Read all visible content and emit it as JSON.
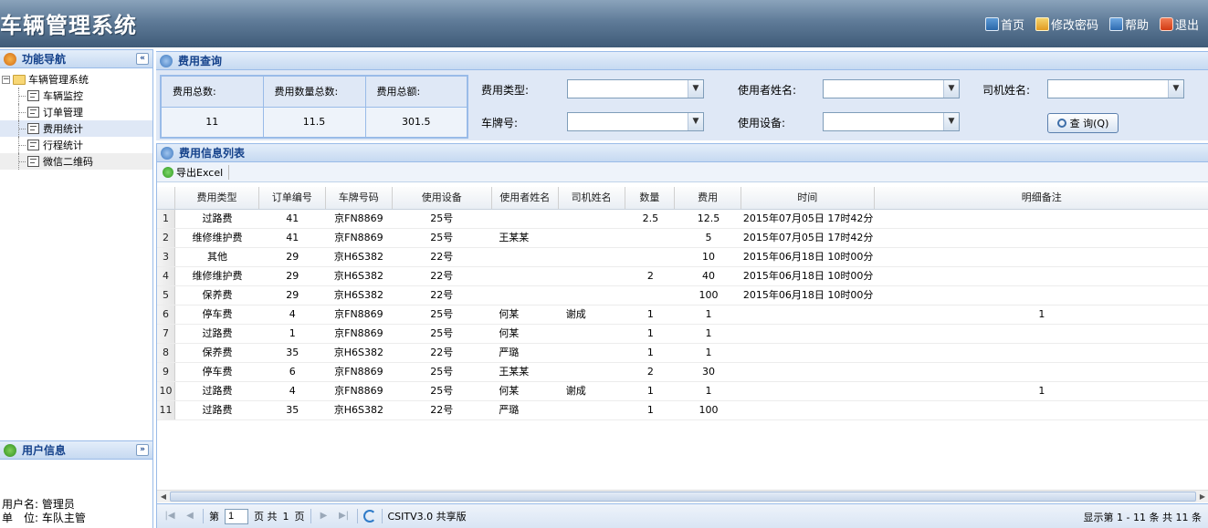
{
  "header": {
    "title": "车辆管理系统",
    "links": [
      {
        "label": "首页",
        "icon": "home-icon"
      },
      {
        "label": "修改密码",
        "icon": "key-icon"
      },
      {
        "label": "帮助",
        "icon": "help-icon"
      },
      {
        "label": "退出",
        "icon": "exit-icon"
      }
    ]
  },
  "sidebar": {
    "nav_title": "功能导航",
    "collapse_glyph": "«",
    "tree": {
      "root_label": "车辆管理系统",
      "items": [
        "车辆监控",
        "订单管理",
        "费用统计",
        "行程统计",
        "微信二维码"
      ],
      "active_item": "费用统计"
    },
    "user_panel": {
      "title": "用户信息",
      "expand_glyph": "»",
      "username_label": "用户名:",
      "username": "管理员",
      "unit_label": "单　位:",
      "unit": "车队主管"
    }
  },
  "query": {
    "title": "费用查询",
    "stats": {
      "count_label": "费用总数:",
      "quantity_label": "费用数量总数:",
      "amount_label": "费用总额:",
      "count": "11",
      "quantity": "11.5",
      "amount": "301.5"
    },
    "fields": {
      "fee_type_label": "费用类型:",
      "user_name_label": "使用者姓名:",
      "driver_name_label": "司机姓名:",
      "plate_label": "车牌号:",
      "device_label": "使用设备:"
    },
    "button_label": "查 询(Q)"
  },
  "list": {
    "title": "费用信息列表",
    "export_label": "导出Excel",
    "columns": [
      "费用类型",
      "订单编号",
      "车牌号码",
      "使用设备",
      "使用者姓名",
      "司机姓名",
      "数量",
      "费用",
      "时间",
      "明细备注"
    ],
    "rows": [
      {
        "n": "1",
        "type": "过路费",
        "order": "41",
        "plate": "京FN8869",
        "device": "25号",
        "user": "",
        "driver": "",
        "qty": "2.5",
        "cost": "12.5",
        "time": "2015年07月05日  17时42分",
        "note": ""
      },
      {
        "n": "2",
        "type": "维修维护费",
        "order": "41",
        "plate": "京FN8869",
        "device": "25号",
        "user": "王某某",
        "driver": "",
        "qty": "",
        "cost": "5",
        "time": "2015年07月05日  17时42分",
        "note": ""
      },
      {
        "n": "3",
        "type": "其他",
        "order": "29",
        "plate": "京H6S382",
        "device": "22号",
        "user": "",
        "driver": "",
        "qty": "",
        "cost": "10",
        "time": "2015年06月18日  10时00分",
        "note": ""
      },
      {
        "n": "4",
        "type": "维修维护费",
        "order": "29",
        "plate": "京H6S382",
        "device": "22号",
        "user": "",
        "driver": "",
        "qty": "2",
        "cost": "40",
        "time": "2015年06月18日  10时00分",
        "note": ""
      },
      {
        "n": "5",
        "type": "保养费",
        "order": "29",
        "plate": "京H6S382",
        "device": "22号",
        "user": "",
        "driver": "",
        "qty": "",
        "cost": "100",
        "time": "2015年06月18日  10时00分",
        "note": ""
      },
      {
        "n": "6",
        "type": "停车费",
        "order": "4",
        "plate": "京FN8869",
        "device": "25号",
        "user": "何某",
        "driver": "谢成",
        "qty": "1",
        "cost": "1",
        "time": "",
        "note": "1"
      },
      {
        "n": "7",
        "type": "过路费",
        "order": "1",
        "plate": "京FN8869",
        "device": "25号",
        "user": "何某",
        "driver": "",
        "qty": "1",
        "cost": "1",
        "time": "",
        "note": ""
      },
      {
        "n": "8",
        "type": "保养费",
        "order": "35",
        "plate": "京H6S382",
        "device": "22号",
        "user": "严璐",
        "driver": "",
        "qty": "1",
        "cost": "1",
        "time": "",
        "note": ""
      },
      {
        "n": "9",
        "type": "停车费",
        "order": "6",
        "plate": "京FN8869",
        "device": "25号",
        "user": "王某某",
        "driver": "",
        "qty": "2",
        "cost": "30",
        "time": "",
        "note": ""
      },
      {
        "n": "10",
        "type": "过路费",
        "order": "4",
        "plate": "京FN8869",
        "device": "25号",
        "user": "何某",
        "driver": "谢成",
        "qty": "1",
        "cost": "1",
        "time": "",
        "note": "1"
      },
      {
        "n": "11",
        "type": "过路费",
        "order": "35",
        "plate": "京H6S382",
        "device": "22号",
        "user": "严璐",
        "driver": "",
        "qty": "1",
        "cost": "100",
        "time": "",
        "note": ""
      }
    ]
  },
  "pager": {
    "page_prefix": "第",
    "page_value": "1",
    "page_mid": "页 共",
    "total_pages": "1",
    "page_suffix": "页",
    "version": "CSITV3.0 共享版",
    "summary": "显示第  1 - 11 条  共  11 条"
  },
  "colors": {
    "accent": "#15428b",
    "panel_border": "#99bbe8",
    "header_bg": "#4f6b88"
  }
}
